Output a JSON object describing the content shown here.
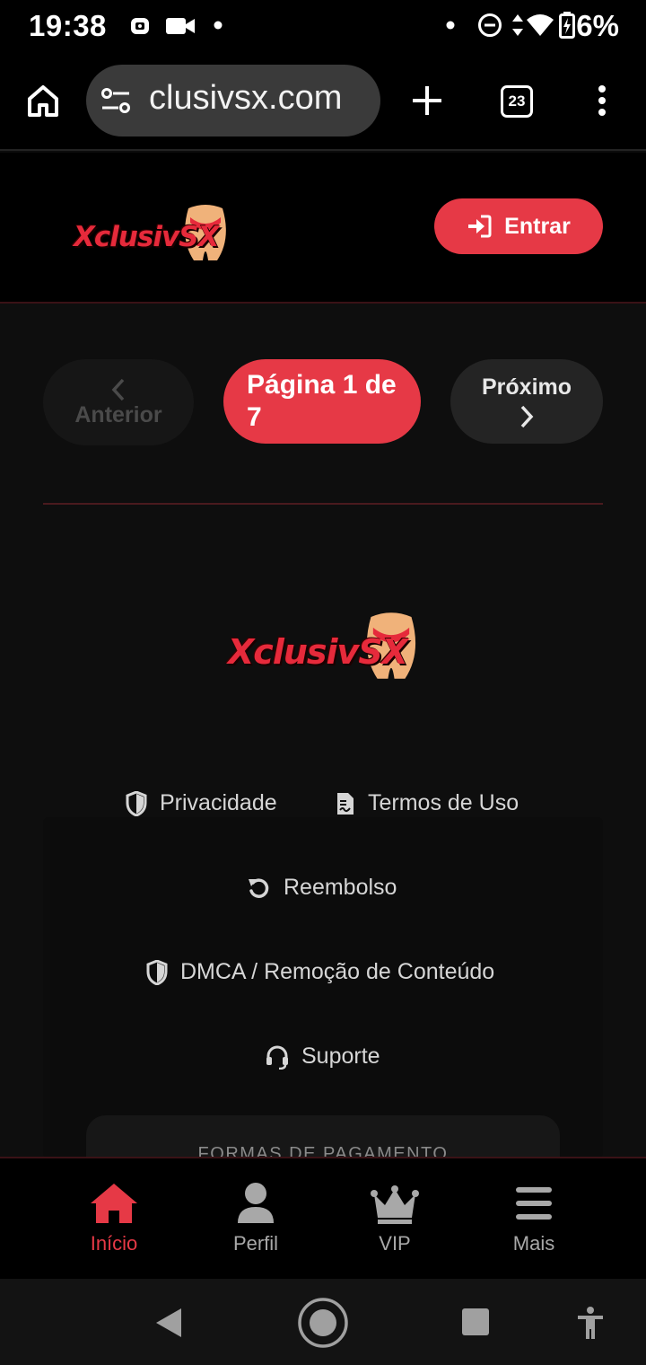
{
  "status_bar": {
    "time": "19:38",
    "battery": "6%",
    "icons": [
      "screen-record-icon",
      "video-icon",
      "notification-dot-icon",
      "dnd-icon",
      "data-arrows-icon",
      "wifi-icon",
      "battery-charging-icon"
    ]
  },
  "browser": {
    "url": "clusivsx.com",
    "tab_count": "23",
    "icons": [
      "home-icon",
      "site-settings-icon",
      "new-tab-icon",
      "menu-dots-icon"
    ]
  },
  "site": {
    "logo_text": "XclusivSX",
    "login_label": "Entrar",
    "accent_color": "#e63946"
  },
  "pagination": {
    "prev_label": "Anterior",
    "current_label": "Página 1 de 7",
    "next_label": "Próximo"
  },
  "footer": {
    "logo_text": "XclusivSX",
    "links": [
      {
        "label": "Privacidade",
        "icon": "shield-icon"
      },
      {
        "label": "Termos de Uso",
        "icon": "document-icon"
      },
      {
        "label": "Reembolso",
        "icon": "refund-icon"
      },
      {
        "label": "DMCA / Remoção de Conteúdo",
        "icon": "shield-icon"
      },
      {
        "label": "Suporte",
        "icon": "headset-icon"
      }
    ],
    "payment_title": "FORMAS DE PAGAMENTO"
  },
  "bottom_nav": {
    "items": [
      {
        "label": "Início",
        "icon": "home-icon",
        "active": true
      },
      {
        "label": "Perfil",
        "icon": "user-icon",
        "active": false
      },
      {
        "label": "VIP",
        "icon": "crown-icon",
        "active": false
      },
      {
        "label": "Mais",
        "icon": "menu-icon",
        "active": false
      }
    ]
  },
  "android_nav": {
    "icons": [
      "back-icon",
      "home-circle-icon",
      "recents-icon",
      "accessibility-icon"
    ]
  }
}
